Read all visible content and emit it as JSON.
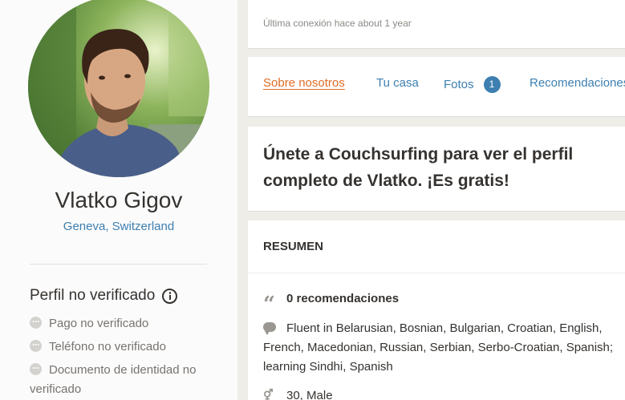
{
  "profile": {
    "name": "Vlatko Gigov",
    "location": "Geneva, Switzerland"
  },
  "verification": {
    "title": "Perfil no verificado",
    "items": [
      "Pago no verificado",
      "Teléfono no verificado",
      "Documento de identidad no verificado"
    ]
  },
  "status": {
    "last_login": "Última conexión hace about 1 year"
  },
  "tabs": [
    {
      "label": "Sobre nosotros"
    },
    {
      "label": "Tu casa"
    },
    {
      "label": "Fotos",
      "badge": "1"
    },
    {
      "label": "Recomendaciones"
    }
  ],
  "join": {
    "text": "Únete a Couchsurfing para ver el perfil completo de Vlatko. ¡Es gratis!"
  },
  "summary": {
    "title": "RESUMEN",
    "references": "0 recomendaciones",
    "languages": "Fluent in Belarusian, Bosnian, Bulgarian, Croatian, English, French, Macedonian, Russian, Serbian, Serbo-Croatian, Spanish; learning Sindhi, Spanish",
    "age_gender": "30, Male"
  },
  "icons": {
    "verification_info": "info-icon",
    "verification_item": "pending-dot-icon",
    "references": "quote-icon",
    "languages": "speech-bubble-icon",
    "gender": "gender-icon"
  },
  "colors": {
    "link": "#3d7fb0",
    "active_tab": "#e06b25",
    "background": "#eeede8"
  }
}
